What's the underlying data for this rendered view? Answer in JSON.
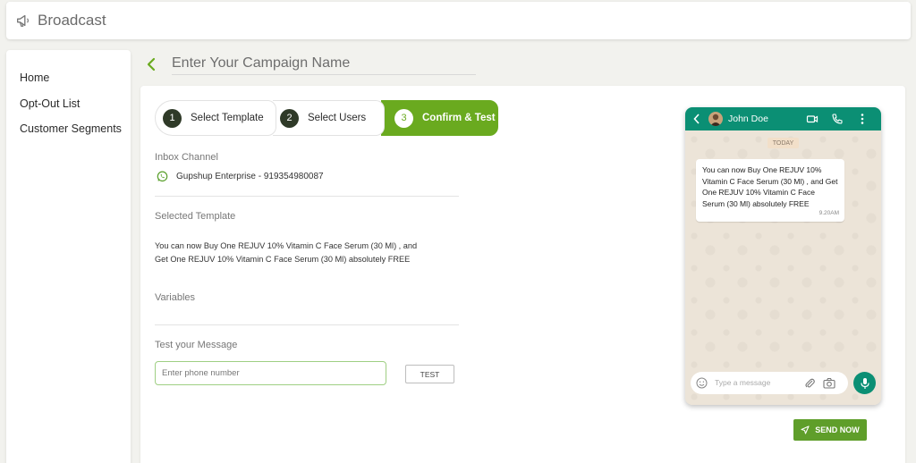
{
  "header": {
    "title": "Broadcast",
    "icon": "megaphone-icon"
  },
  "sidebar": {
    "items": [
      {
        "label": "Home"
      },
      {
        "label": "Opt-Out List"
      },
      {
        "label": "Customer Segments"
      }
    ]
  },
  "campaign": {
    "placeholder": "Enter Your Campaign Name",
    "value": ""
  },
  "steps": [
    {
      "number": "1",
      "label": "Select Template",
      "state": "done"
    },
    {
      "number": "2",
      "label": "Select Users",
      "state": "done"
    },
    {
      "number": "3",
      "label": "Confirm & Test",
      "state": "active"
    }
  ],
  "inbox_channel": {
    "label": "Inbox Channel",
    "value": "Gupshup Enterprise - 919354980087",
    "icon": "whatsapp-icon"
  },
  "selected_template": {
    "label": "Selected Template",
    "text": "You can now Buy One REJUV 10% Vitamin C Face Serum (30 Ml) , and Get One REJUV 10% Vitamin C Face Serum (30 Ml) absolutely FREE"
  },
  "variables": {
    "label": "Variables"
  },
  "test": {
    "label": "Test your Message",
    "placeholder": "Enter phone number",
    "button": "TEST"
  },
  "preview": {
    "contact": "John Doe",
    "date_chip": "TODAY",
    "message": "You can now Buy One REJUV 10% Vitamin C Face Serum (30 Ml) , and Get One REJUV 10% Vitamin C Face Serum (30 Ml) absolutely FREE",
    "time": "9.20AM",
    "composer_placeholder": "Type a message"
  },
  "actions": {
    "send_now": "SEND NOW"
  },
  "colors": {
    "accent": "#6aaa1f",
    "whatsapp_header": "#0b8f74",
    "send_button": "#5f9e2a"
  }
}
